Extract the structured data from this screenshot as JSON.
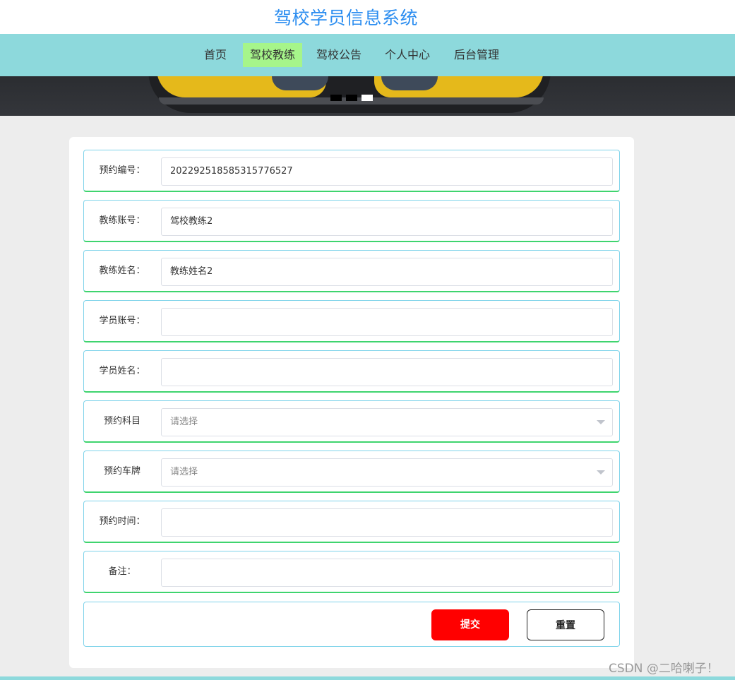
{
  "site": {
    "title": "驾校学员信息系统"
  },
  "nav": {
    "items": [
      {
        "label": "首页",
        "active": false
      },
      {
        "label": "驾校教练",
        "active": true
      },
      {
        "label": "驾校公告",
        "active": false
      },
      {
        "label": "个人中心",
        "active": false
      },
      {
        "label": "后台管理",
        "active": false
      }
    ]
  },
  "banner": {
    "slides": 3,
    "active_slide_number": 3
  },
  "form": {
    "fields": [
      {
        "label": "预约编号：",
        "value": "202292518585315776527",
        "placeholder": ""
      },
      {
        "label": "教练账号：",
        "value": "驾校教练2",
        "placeholder": ""
      },
      {
        "label": "教练姓名：",
        "value": "教练姓名2",
        "placeholder": ""
      },
      {
        "label": "学员账号：",
        "value": "",
        "placeholder": ""
      },
      {
        "label": "学员姓名：",
        "value": "",
        "placeholder": ""
      },
      {
        "label": "预约科目",
        "value": "",
        "placeholder": "请选择"
      },
      {
        "label": "预约车牌",
        "value": "",
        "placeholder": "请选择"
      },
      {
        "label": "预约时间：",
        "value": "",
        "placeholder": ""
      },
      {
        "label": "备注：",
        "value": "",
        "placeholder": ""
      }
    ],
    "submit_label": "提交",
    "reset_label": "重置"
  },
  "watermark": "CSDN @二哈喇子！",
  "colors": {
    "title": "#2b8df0",
    "navbar": "#8dd9dc",
    "nav_active": "#a6f58a",
    "submit": "#ff0000",
    "row_border": "#7fd3ea",
    "row_bottom_border": "#3fd46e"
  }
}
